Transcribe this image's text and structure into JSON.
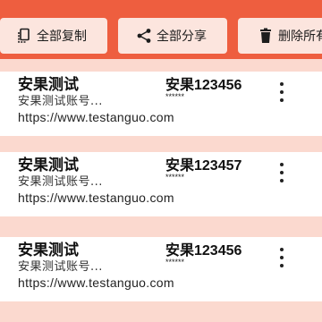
{
  "toolbar": {
    "copy_all_label": "全部复制",
    "share_all_label": "全部分享",
    "delete_all_label": "删除所有"
  },
  "items": [
    {
      "name": "安果测试",
      "note": "安果测试账号...",
      "account": "安果123456",
      "password": "******",
      "url": "https://www.testanguo.com"
    },
    {
      "name": "安果测试",
      "note": "安果测试账号...",
      "account": "安果123457",
      "password": "******",
      "url": "https://www.testanguo.com"
    },
    {
      "name": "安果测试",
      "note": "安果测试账号...",
      "account": "安果123456",
      "password": "******",
      "url": "https://www.testanguo.com"
    }
  ],
  "colors": {
    "toolbar": "#EE5E3F",
    "background": "#FBD9CF",
    "button": "#FCE5DE",
    "card": "#FFFFFF"
  },
  "icons": {
    "copy": "copy-icon",
    "share": "share-icon",
    "delete": "trash-icon",
    "more": "more-vertical-icon"
  }
}
